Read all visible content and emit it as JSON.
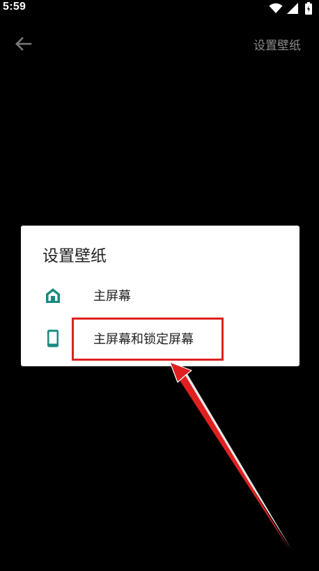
{
  "status_bar": {
    "time": "5:59"
  },
  "toolbar": {
    "back_icon": "arrow-left-icon",
    "action_label": "设置壁纸"
  },
  "dialog": {
    "title": "设置壁纸",
    "options": [
      {
        "icon": "home-icon",
        "label": "主屏幕"
      },
      {
        "icon": "phone-icon",
        "label": "主屏幕和锁定屏幕"
      }
    ]
  },
  "colors": {
    "background": "#000000",
    "dialog_background": "#ffffff",
    "icon_accent": "#1a8a80",
    "annotation_red": "#e02020",
    "toolbar_text": "#8a8a8a"
  }
}
